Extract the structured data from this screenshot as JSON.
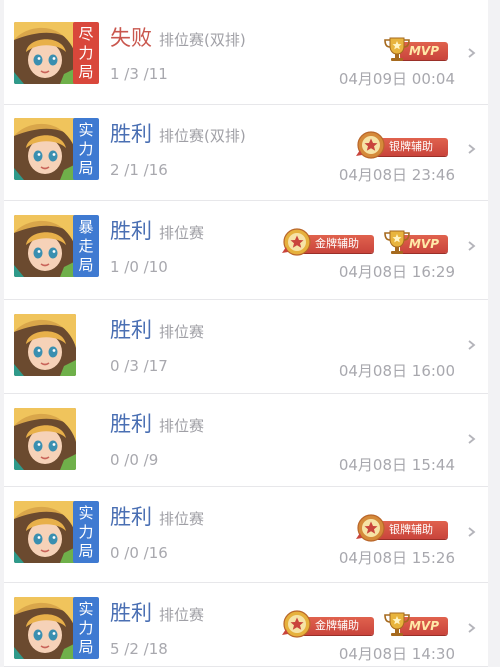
{
  "colors": {
    "win": "#4a6fb3",
    "lose": "#c9564d",
    "tag_red": "#d9473b",
    "tag_blue": "#3f7ad1",
    "ribbon": "#d5503f",
    "muted": "#a8a8ae"
  },
  "matches": [
    {
      "result": "失败",
      "result_type": "lose",
      "mode": "排位赛(双排)",
      "kda": "1 /3 /11",
      "date": "04月09日 00:04",
      "tag": [
        "尽",
        "力",
        "局"
      ],
      "tag_color": "red",
      "badges": [
        "MVP"
      ]
    },
    {
      "result": "胜利",
      "result_type": "win",
      "mode": "排位赛(双排)",
      "kda": "2 /1 /16",
      "date": "04月08日 23:46",
      "tag": [
        "实",
        "力",
        "局"
      ],
      "tag_color": "blue",
      "badges": [
        "银牌辅助"
      ]
    },
    {
      "result": "胜利",
      "result_type": "win",
      "mode": "排位赛",
      "kda": "1 /0 /10",
      "date": "04月08日 16:29",
      "tag": [
        "暴",
        "走",
        "局"
      ],
      "tag_color": "blue",
      "badges": [
        "金牌辅助",
        "MVP"
      ]
    },
    {
      "result": "胜利",
      "result_type": "win",
      "mode": "排位赛",
      "kda": "0 /3 /17",
      "date": "04月08日 16:00",
      "tag": [],
      "tag_color": "",
      "badges": []
    },
    {
      "result": "胜利",
      "result_type": "win",
      "mode": "排位赛",
      "kda": "0 /0 /9",
      "date": "04月08日 15:44",
      "tag": [],
      "tag_color": "",
      "badges": []
    },
    {
      "result": "胜利",
      "result_type": "win",
      "mode": "排位赛",
      "kda": "0 /0 /16",
      "date": "04月08日 15:26",
      "tag": [
        "实",
        "力",
        "局"
      ],
      "tag_color": "blue",
      "badges": [
        "银牌辅助"
      ]
    },
    {
      "result": "胜利",
      "result_type": "win",
      "mode": "排位赛",
      "kda": "5 /2 /18",
      "date": "04月08日 14:30",
      "tag": [
        "实",
        "力",
        "局"
      ],
      "tag_color": "blue",
      "badges": [
        "金牌辅助",
        "MVP"
      ]
    }
  ],
  "icons": {
    "chevron": "chevron-right-icon",
    "medal": "medal-icon",
    "trophy": "trophy-icon"
  }
}
